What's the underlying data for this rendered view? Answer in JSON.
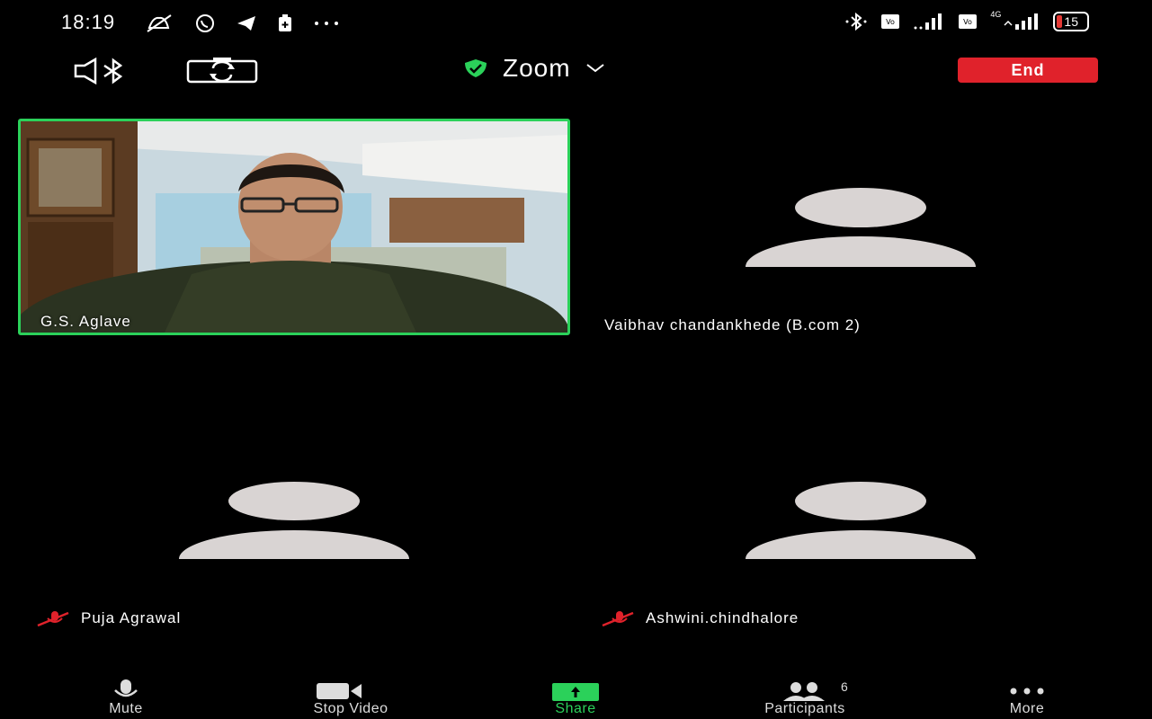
{
  "status_bar": {
    "time": "18:19",
    "battery": "15",
    "network_type": "4G",
    "icons": [
      "muted-notification-icon",
      "whatsapp-icon",
      "telegram-icon",
      "battery-saver-icon",
      "more-dots-icon",
      "bluetooth-icon",
      "volte-icon",
      "signal-icon",
      "volte-icon",
      "signal-icon"
    ]
  },
  "meeting_header": {
    "title": "Zoom",
    "end_label": "End",
    "shield_color": "#2bd15a",
    "end_color": "#e0222b"
  },
  "participants": [
    {
      "name": "G.S. Aglave",
      "video_on": true,
      "active_speaker": true
    },
    {
      "name": "Vaibhav chandankhede (B.com 2)",
      "video_on": false,
      "muted": false
    },
    {
      "name": "Puja Agrawal",
      "video_on": false,
      "muted": true
    },
    {
      "name": "Ashwini.chindhalore",
      "video_on": false,
      "muted": true
    }
  ],
  "toolbar": {
    "mute_label": "Mute",
    "stop_video_label": "Stop Video",
    "share_label": "Share",
    "participants_label": "Participants",
    "participants_count": "6",
    "more_label": "More",
    "accent_color": "#2bd15a"
  }
}
